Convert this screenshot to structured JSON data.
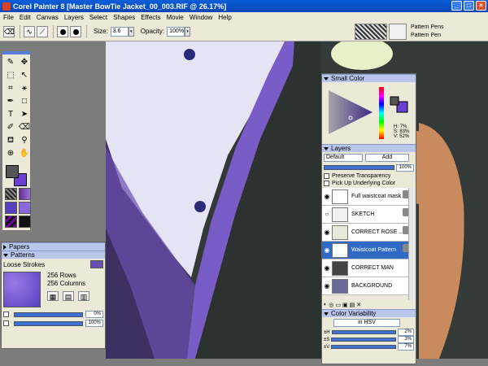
{
  "window": {
    "title": "Corel Painter 8 [Master BowTie Jacket_00_003.RIF @ 26.17%]",
    "minimize": "_",
    "maximize": "□",
    "close": "×"
  },
  "menu": [
    "File",
    "Edit",
    "Canvas",
    "Layers",
    "Select",
    "Shapes",
    "Effects",
    "Movie",
    "Window",
    "Help"
  ],
  "properties": {
    "size_label": "Size:",
    "size_value": "3.6",
    "opacity_label": "Opacity:",
    "opacity_value": "100%",
    "pattern_category": "Pattern Pens",
    "pattern_variant": "Pattern Pen"
  },
  "papers_panel": {
    "papers_title": "Papers",
    "patterns_title": "Patterns",
    "pattern_name": "Loose Strokes",
    "rows": "256 Rows",
    "columns": "256 Columns",
    "slider1_value": "0%",
    "slider2_value": "100%"
  },
  "color_panel": {
    "title": "Small Color",
    "hsv_h": "H: 7%",
    "hsv_s": "S: 83%",
    "hsv_v": "V: 52%",
    "main_color": "#6b3fd2"
  },
  "layers_panel": {
    "title": "Layers",
    "composite_method": "Default",
    "composite_op": "Add",
    "opacity": "100%",
    "preserve_transparency": "Preserve Transparency",
    "pick_up_color": "Pick Up Underlying Color",
    "layers": [
      {
        "name": "Full waistcoat mask",
        "selected": false
      },
      {
        "name": "SKETCH",
        "selected": false
      },
      {
        "name": "CORRECT ROSE ...",
        "selected": false
      },
      {
        "name": "Waistcoat Pattern",
        "selected": true
      },
      {
        "name": "CORRECT MAN",
        "selected": false
      },
      {
        "name": "BACKGROUND",
        "selected": false
      }
    ]
  },
  "variability_panel": {
    "title": "Color Variability",
    "mode": "in HSV",
    "h_label": "±H",
    "h_value": "2%",
    "s_label": "±S",
    "s_value": "3%",
    "v_label": "±V",
    "v_value": "7%"
  }
}
